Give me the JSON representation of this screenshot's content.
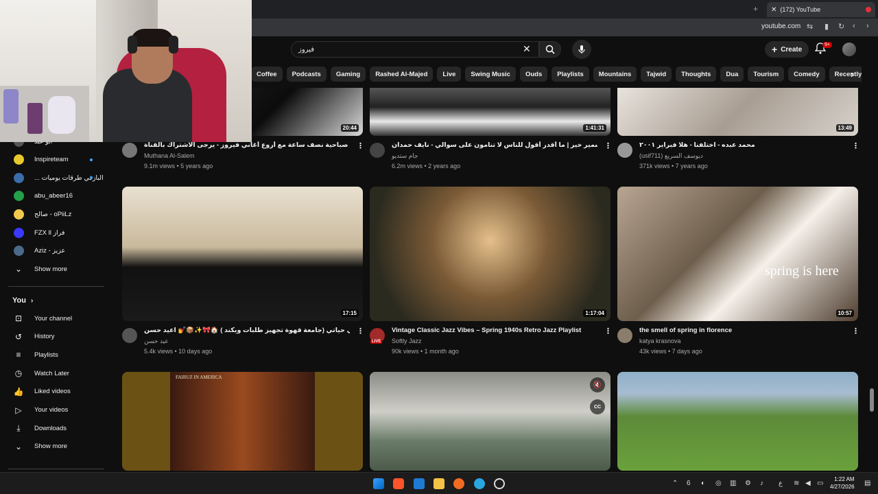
{
  "browser": {
    "tab_title": "(172) YouTube",
    "url": "youtube.com"
  },
  "header": {
    "search_value": "فيروز",
    "create_label": "Create",
    "notif_count": "9+"
  },
  "chips": [
    "Coffee",
    "Podcasts",
    "Gaming",
    "Rashed Al-Majed",
    "Live",
    "Swing Music",
    "Ouds",
    "Playlists",
    "Mountains",
    "Tajwid",
    "Thoughts",
    "Dua",
    "Tourism",
    "Comedy",
    "Recently uploaded"
  ],
  "sidebar": {
    "subscriptions": [
      {
        "label": "ابو عبد",
        "dot": false
      },
      {
        "label": "Inspireteam",
        "dot": true
      },
      {
        "label": "... البازفي طرقات يوميات",
        "dot": true
      },
      {
        "label": "abu_abeer16",
        "dot": false
      },
      {
        "label": "صالح - oPiiLz",
        "dot": false
      },
      {
        "label": "FZX ll فراز",
        "dot": false
      },
      {
        "label": "Aziz - عزيز",
        "dot": false
      },
      {
        "label": "Show more",
        "dot": false
      }
    ],
    "you_heading": "You",
    "you_items": [
      {
        "label": "Your channel",
        "icon": "person-box-icon"
      },
      {
        "label": "History",
        "icon": "history-icon"
      },
      {
        "label": "Playlists",
        "icon": "playlist-icon"
      },
      {
        "label": "Watch Later",
        "icon": "clock-icon"
      },
      {
        "label": "Liked videos",
        "icon": "thumb-up-icon"
      },
      {
        "label": "Your videos",
        "icon": "play-box-icon"
      },
      {
        "label": "Downloads",
        "icon": "download-icon"
      },
      {
        "label": "Show more",
        "icon": "chevron-down-icon"
      }
    ]
  },
  "videos": [
    {
      "title": "فيروزيات صباحية نصف ساعة مع أروع أغاني فيروز - يرجى الاشتراك بالقناة",
      "channel": "Muthana Al-Salem",
      "meta": "9.1m views • 5 years ago",
      "duration": "20:44"
    },
    {
      "title": "بودكاست بسمير خير | ما أقدر أقول للناس لا تنامون على سوالي - نايف حمدان",
      "channel": "جام ستديو",
      "meta": "6.2m views • 2 years ago",
      "duration": "1:41:31"
    },
    {
      "title": "محمد عبده - اختلفنا - هلا فبراير ٢٠٠١",
      "channel": "(usif711) ديوسف السريع",
      "meta": "371k views • 7 years ago",
      "duration": "13:49"
    },
    {
      "title": "أسبوع في حياتي (جامعة قهوة تجهيز طلبات ويكند ) 🏠🎀✨📦💅 اعيد حسن 💫",
      "channel": "عيد حسن",
      "meta": "5.4k views • 10 days ago",
      "duration": "17:15"
    },
    {
      "title": "Vintage Classic Jazz Vibes – Spring 1940s Retro Jazz Playlist",
      "channel": "Softly Jazz",
      "meta": "90k views • 1 month ago",
      "duration": "1:17:04",
      "live": "LIVE"
    },
    {
      "title": "the smell of spring in florence",
      "channel": "katya krasnova",
      "meta": "43k views • 7 days ago",
      "duration": "10:57",
      "overlay": "spring is here"
    },
    {
      "title": "",
      "channel": "",
      "meta": "",
      "duration": "",
      "overlay": "FAIRUZ IN AMERICA"
    },
    {
      "title": "",
      "channel": "",
      "meta": "",
      "duration": ""
    },
    {
      "title": "",
      "channel": "",
      "meta": "",
      "duration": ""
    }
  ],
  "taskbar": {
    "time": "1:22 AM",
    "date": "4/27/2026",
    "lang": "ع"
  }
}
